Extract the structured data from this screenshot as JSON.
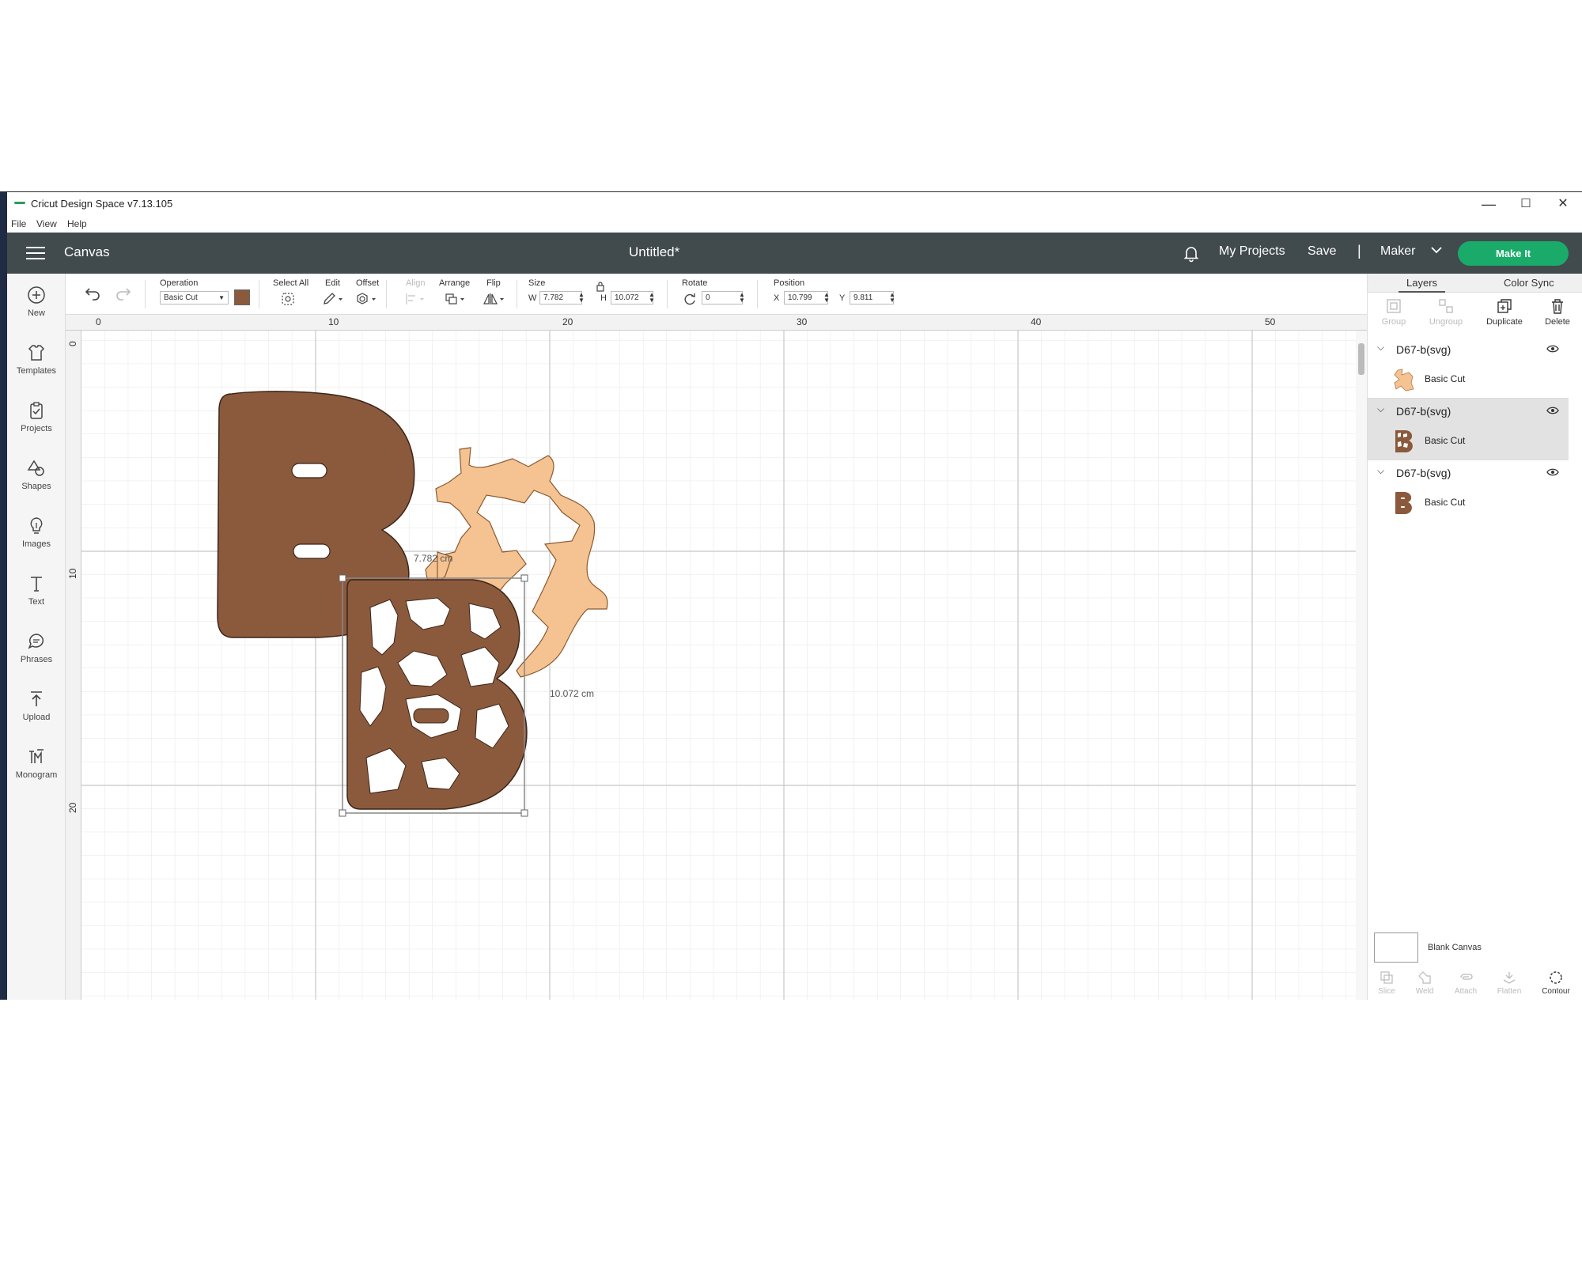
{
  "window": {
    "title": "Cricut Design Space  v7.13.105",
    "minimize": "—",
    "maximize": "☐",
    "close": "✕"
  },
  "menu": [
    "File",
    "View",
    "Help"
  ],
  "header": {
    "section": "Canvas",
    "document_title": "Untitled*",
    "my_projects": "My Projects",
    "save": "Save",
    "separator": "|",
    "machine": "Maker",
    "make_it": "Make It",
    "make_it_color": "#1aab6a"
  },
  "sidebar": [
    {
      "label": "New",
      "icon": "plus-circle-icon"
    },
    {
      "label": "Templates",
      "icon": "shirt-icon"
    },
    {
      "label": "Projects",
      "icon": "clipboard-icon"
    },
    {
      "label": "Shapes",
      "icon": "shapes-icon"
    },
    {
      "label": "Images",
      "icon": "bulb-icon"
    },
    {
      "label": "Text",
      "icon": "text-icon"
    },
    {
      "label": "Phrases",
      "icon": "speech-bubble-icon"
    },
    {
      "label": "Upload",
      "icon": "upload-icon"
    },
    {
      "label": "Monogram",
      "icon": "monogram-icon"
    }
  ],
  "toolbar": {
    "operation_label": "Operation",
    "operation_value": "Basic Cut",
    "operation_color": "#8b5a3c",
    "select_all": "Select All",
    "edit": "Edit",
    "offset": "Offset",
    "align": "Align",
    "arrange": "Arrange",
    "flip": "Flip",
    "size_label": "Size",
    "w_label": "W",
    "w_value": "7.782",
    "h_label": "H",
    "h_value": "10.072",
    "rotate_label": "Rotate",
    "rotate_value": "0",
    "position_label": "Position",
    "x_label": "X",
    "x_value": "10.799",
    "y_label": "Y",
    "y_value": "9.811"
  },
  "rulers": {
    "top": [
      "0",
      "10",
      "20",
      "30",
      "40",
      "50"
    ],
    "left": [
      "0",
      "10",
      "20"
    ]
  },
  "canvas": {
    "width_measure": "7.782 cm",
    "height_measure": "10.072 cm",
    "brown": "#8b5a3c",
    "tan": "#f5c291"
  },
  "panel": {
    "tabs": [
      "Layers",
      "Color Sync"
    ],
    "actions": [
      {
        "label": "Group",
        "enabled": false
      },
      {
        "label": "Ungroup",
        "enabled": false
      },
      {
        "label": "Duplicate",
        "enabled": true
      },
      {
        "label": "Delete",
        "enabled": true
      }
    ],
    "layers": [
      {
        "name": "D67-b(svg)",
        "operation": "Basic Cut",
        "selected": false,
        "thumb": "tan"
      },
      {
        "name": "D67-b(svg)",
        "operation": "Basic Cut",
        "selected": true,
        "thumb": "pattern"
      },
      {
        "name": "D67-b(svg)",
        "operation": "Basic Cut",
        "selected": false,
        "thumb": "solid"
      }
    ],
    "blank_canvas": "Blank Canvas",
    "bottom_actions": [
      {
        "label": "Slice",
        "enabled": false
      },
      {
        "label": "Weld",
        "enabled": false
      },
      {
        "label": "Attach",
        "enabled": false
      },
      {
        "label": "Flatten",
        "enabled": false
      },
      {
        "label": "Contour",
        "enabled": true
      }
    ]
  }
}
